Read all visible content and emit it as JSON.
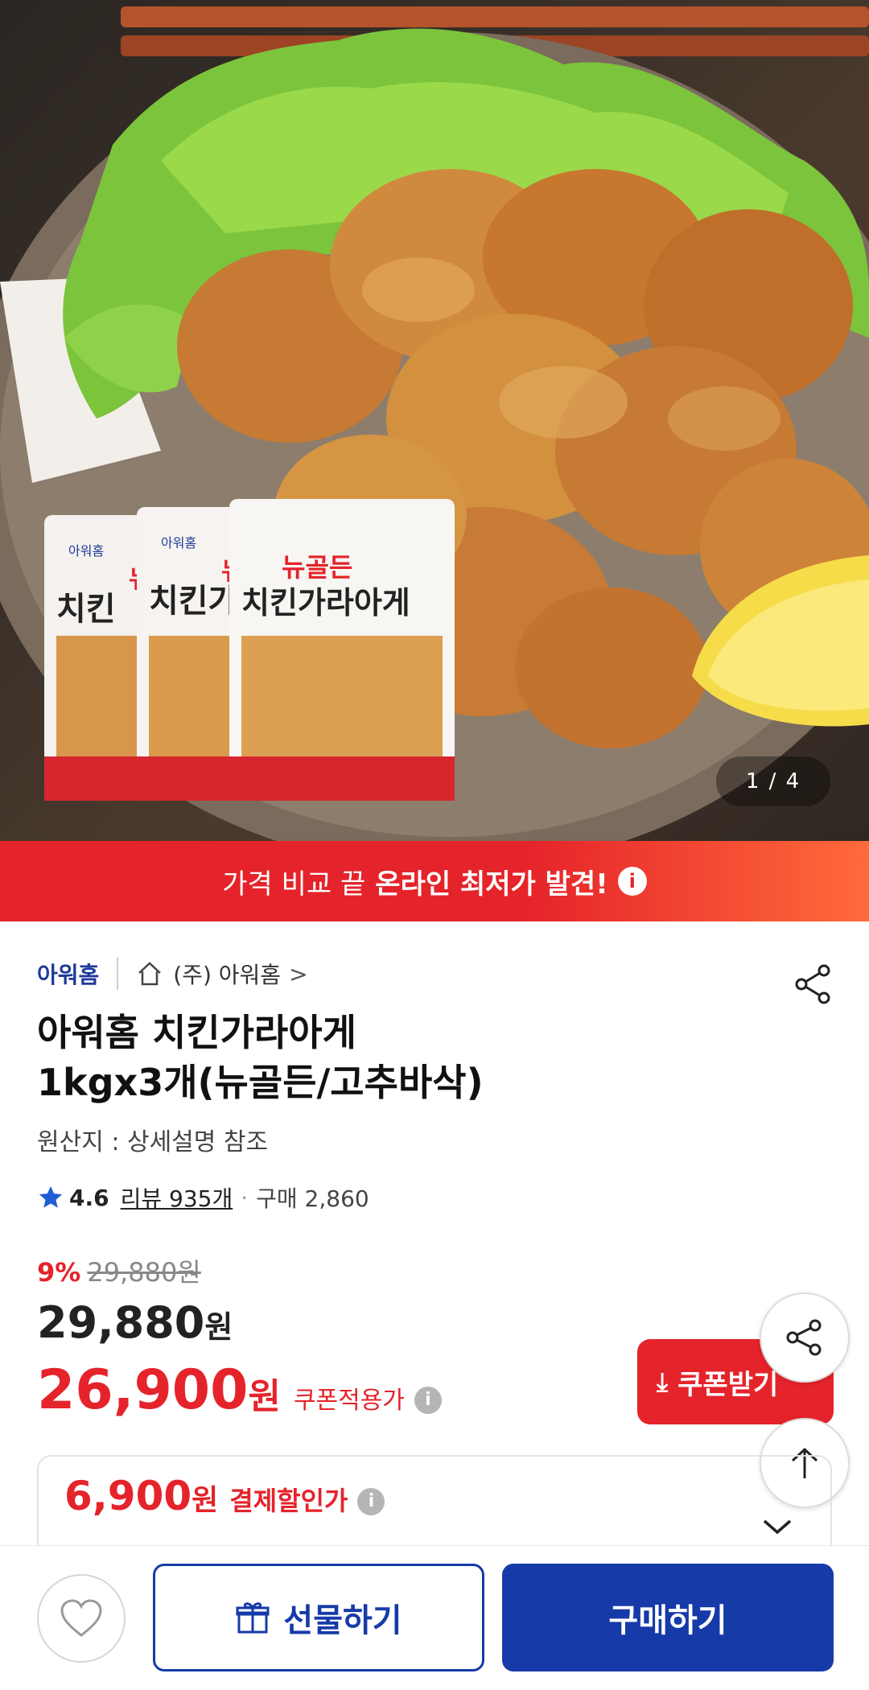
{
  "hero": {
    "counter": "1 / 4",
    "package_brand": "뉴골든",
    "package_name": "치킨가라아게"
  },
  "promo": {
    "text": "가격 비교 끝",
    "highlight": "온라인 최저가 발견!",
    "info_icon": "i"
  },
  "seller": {
    "logo": "아워홈",
    "store": "(주) 아워홈",
    "chevron": ">"
  },
  "product": {
    "title_line1": "아워홈 치킨가라아게",
    "title_line2": "1kgx3개(뉴골든/고추바삭)",
    "origin": "원산지 : 상세설명 참조"
  },
  "rating": {
    "score": "4.6",
    "reviews": "리뷰 935개",
    "separator": "·",
    "buys": "구매 2,860"
  },
  "price": {
    "discount_pct": "9%",
    "original": "29,880원",
    "main_number": "29,880",
    "main_unit": "원",
    "coupon_number": "26,900",
    "coupon_unit": "원",
    "coupon_label": "쿠폰적용가",
    "coupon_button": "쿠폰받기",
    "pay_number": "6,900",
    "pay_unit": "원",
    "pay_label": "결제할인가"
  },
  "bottom": {
    "gift_label": "선물하기",
    "buy_label": "구매하기"
  },
  "colors": {
    "accent_red": "#e5232a",
    "brand_blue": "#163aa8"
  }
}
